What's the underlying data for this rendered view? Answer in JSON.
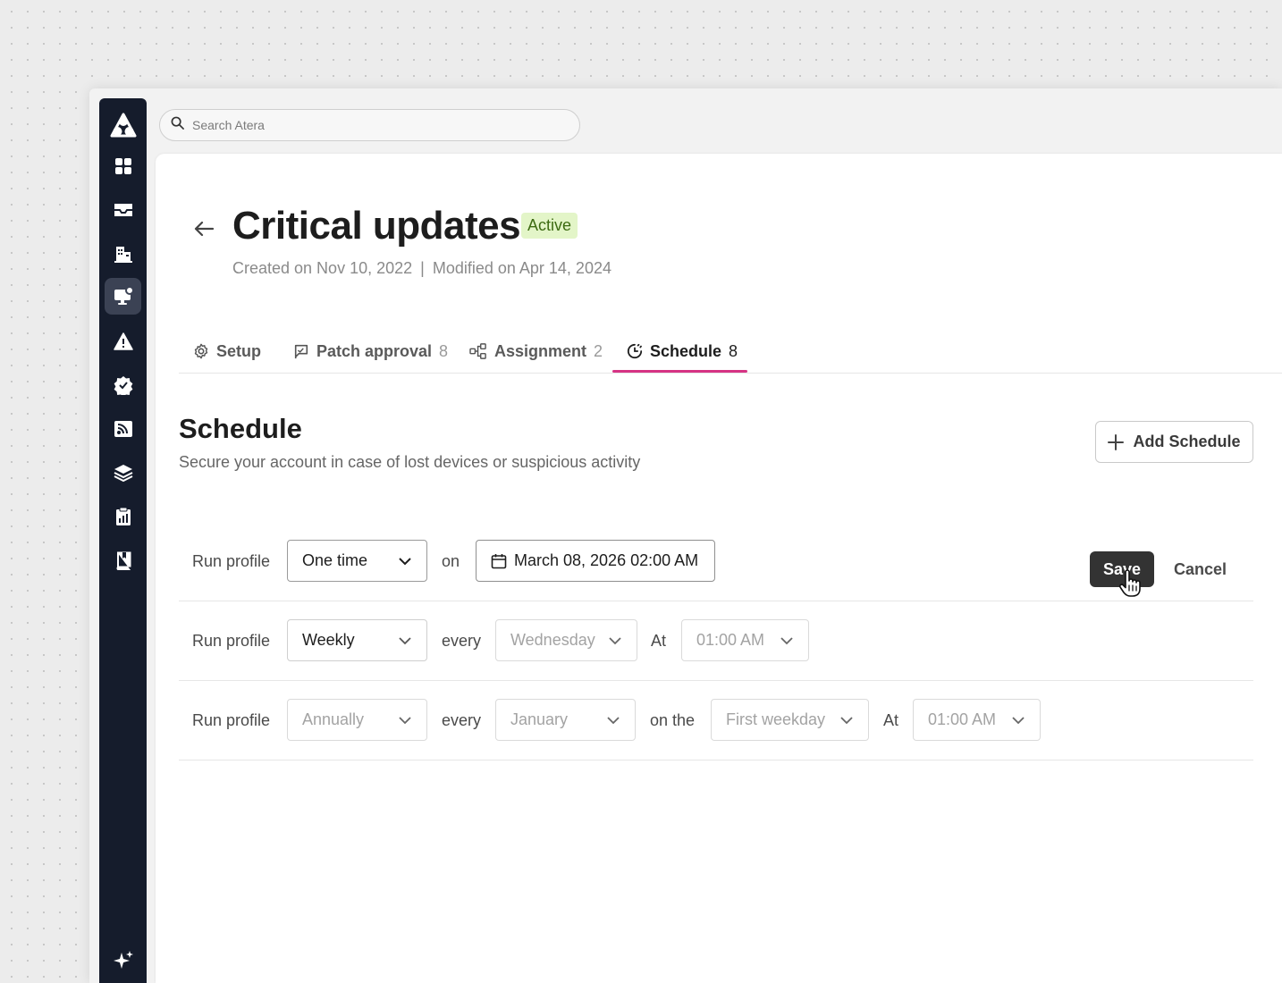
{
  "search": {
    "placeholder": "Search Atera"
  },
  "sidebar": {
    "items": [
      {
        "icon": "atera-logo-icon"
      },
      {
        "icon": "dashboard-icon"
      },
      {
        "icon": "tickets-icon"
      },
      {
        "icon": "customers-icon"
      },
      {
        "icon": "devices-icon",
        "active": true
      },
      {
        "icon": "alerts-icon"
      },
      {
        "icon": "patch-icon"
      },
      {
        "icon": "feeds-icon"
      },
      {
        "icon": "layers-icon"
      },
      {
        "icon": "reports-icon"
      },
      {
        "icon": "knowledge-base-icon"
      },
      {
        "icon": "ai-sparkle-icon"
      }
    ]
  },
  "header": {
    "title": "Critical updates",
    "status": "Active",
    "created": "Created on Nov 10, 2022",
    "separator": "|",
    "modified": "Modified on Apr 14, 2024"
  },
  "tabs": [
    {
      "label": "Setup",
      "count": ""
    },
    {
      "label": "Patch approval",
      "count": "8"
    },
    {
      "label": "Assignment",
      "count": "2"
    },
    {
      "label": "Schedule",
      "count": "8",
      "active": true
    }
  ],
  "section": {
    "title": "Schedule",
    "subtitle": "Secure your account in case of lost devices or suspicious activity",
    "add_label": "Add Schedule"
  },
  "rows": [
    {
      "run_label": "Run profile",
      "frequency": "One time",
      "on_label": "on",
      "datetime": "March 08, 2026 02:00 AM",
      "save_label": "Save",
      "cancel_label": "Cancel"
    },
    {
      "run_label": "Run profile",
      "frequency": "Weekly",
      "every_label": "every",
      "day": "Wednesday",
      "at_label": "At",
      "time": "01:00 AM"
    },
    {
      "run_label": "Run profile",
      "frequency": "Annually",
      "every_label": "every",
      "month": "January",
      "on_the_label": "on the",
      "weekday": "First weekday",
      "at_label": "At",
      "time": "01:00 AM"
    }
  ],
  "colors": {
    "sidebar_bg": "#151c2c",
    "accent_tab": "#d63384",
    "badge_bg": "#e3f5c8",
    "badge_text": "#3d6b12",
    "save_bg": "#333333"
  }
}
